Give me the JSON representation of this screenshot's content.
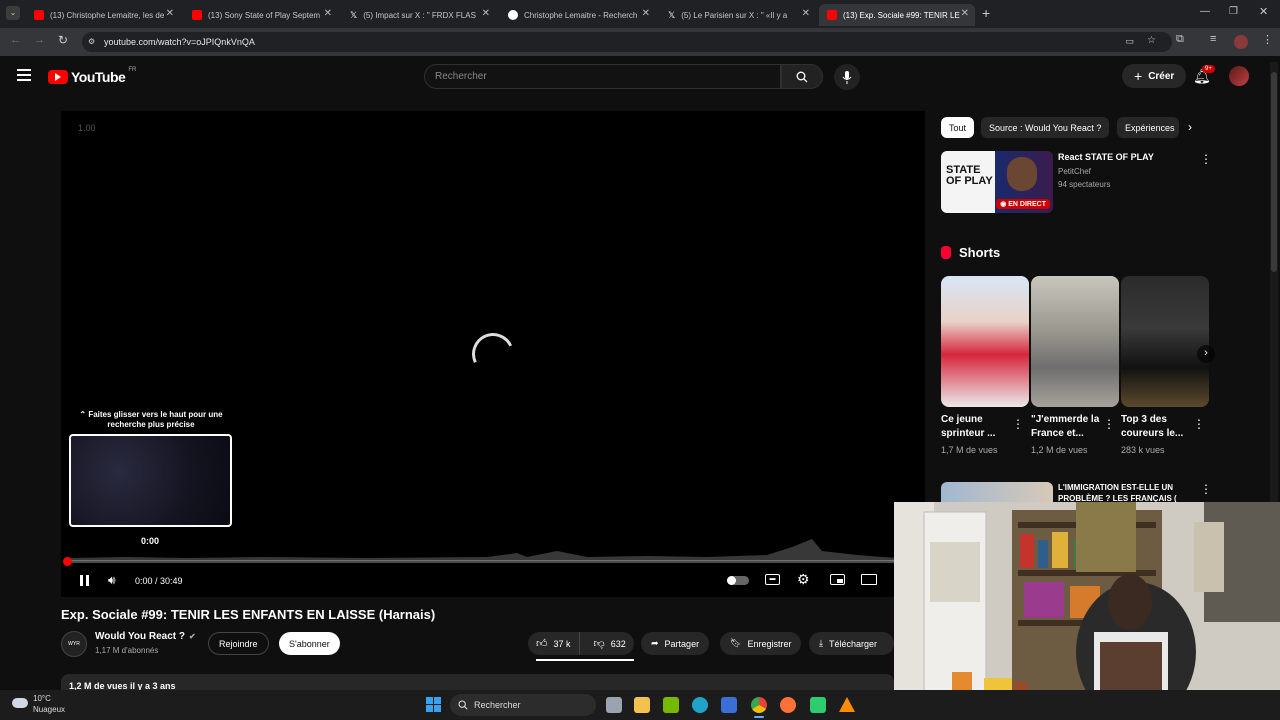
{
  "browser": {
    "tabs": [
      {
        "title": "(13) Christophe Lemaitre, les de",
        "favicon_color": "#ff0000"
      },
      {
        "title": "(13) Sony State of Play Septem",
        "favicon_color": "#ff0000"
      },
      {
        "title": "(5) Impact sur X : \" FRDX FLAS",
        "favicon_color": "#ffffff"
      },
      {
        "title": "Christophe Lemaitre - Recherch",
        "favicon_color": "#4285f4"
      },
      {
        "title": "(5) Le Parisien sur X : \" «Il y a",
        "favicon_color": "#ffffff"
      },
      {
        "title": "(13) Exp. Sociale #99: TENIR LE",
        "favicon_color": "#ff0000"
      }
    ],
    "new_tab_label": "+",
    "url": "youtube.com/watch?v=oJPIQnkVnQA"
  },
  "youtube": {
    "logo_text": "YouTube",
    "logo_region": "FR",
    "search_placeholder": "Rechercher",
    "create_label": "Créer",
    "notif_badge": "9+",
    "chips": [
      "Tout",
      "Source : Would You React ?",
      "Expériences"
    ],
    "player": {
      "time": "0:00 / 30:49",
      "corner_text": "1.00",
      "seek_hint": "Faites glisser vers le haut pour une recherche plus précise",
      "preview_time": "0:00",
      "progress": 0.0
    },
    "video": {
      "title": "Exp. Sociale #99: TENIR LES ENFANTS EN LAISSE (Harnais)",
      "channel": "Would You React ?",
      "subscribers": "1,17 M d'abonnés",
      "join_label": "Rejoindre",
      "subscribe_label": "S'abonner",
      "likes": "37 k",
      "dislikes": "632",
      "share_label": "Partager",
      "save_label": "Enregistrer",
      "download_label": "Télécharger",
      "meta": "1,2 M de vues  il y a 3 ans"
    },
    "sidebar": {
      "live": {
        "title": "React STATE OF PLAY",
        "channel": "PetitChef",
        "viewers": "94 spectateurs",
        "thumb_text": "STATE OF PLAY",
        "badge": "EN DIRECT"
      },
      "shorts_heading": "Shorts",
      "shorts": [
        {
          "title": "Ce jeune sprinteur ...",
          "views": "1,7 M de vues"
        },
        {
          "title": "\"J'emmerde la France et...",
          "views": "1,2 M de vues"
        },
        {
          "title": "Top 3 des coureurs le...",
          "views": "283 k vues"
        }
      ],
      "next_video_title": "L'IMMIGRATION EST-ELLE UN PROBLÈME ? LES FRANÇAIS ("
    }
  },
  "taskbar": {
    "weather_temp": "10°C",
    "weather_desc": "Nuageux",
    "search_placeholder": "Rechercher"
  }
}
